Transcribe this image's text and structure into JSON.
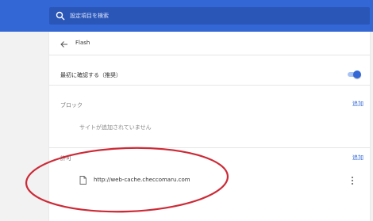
{
  "search": {
    "placeholder": "設定項目を検索"
  },
  "header": {
    "title": "Flash"
  },
  "toggle": {
    "label": "最初に確認する（推奨）",
    "on": true
  },
  "block": {
    "label": "ブロック",
    "add_label": "追加",
    "empty_text": "サイトが追加されていません"
  },
  "allow": {
    "label": "許可",
    "add_label": "追加",
    "items": [
      {
        "url": "http://web-cache.checcomaru.com"
      }
    ]
  },
  "colors": {
    "accent": "#3367d6",
    "annotation": "#cc2a36"
  }
}
